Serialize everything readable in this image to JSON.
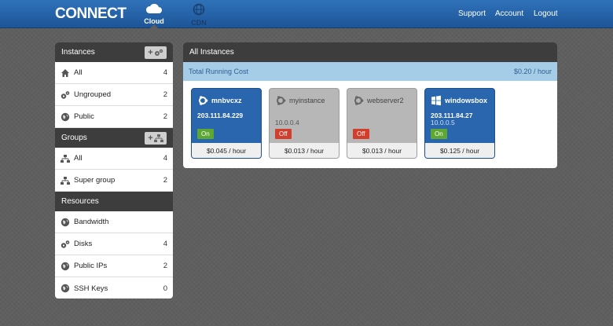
{
  "topbar": {
    "logo": "CONNECT",
    "tabs": [
      {
        "label": "Cloud",
        "icon": "cloud-icon"
      },
      {
        "label": "CDN",
        "icon": "globe-icon"
      }
    ],
    "links": [
      "Support",
      "Account",
      "Logout"
    ]
  },
  "sidebar": {
    "instances": {
      "title": "Instances",
      "items": [
        {
          "label": "All",
          "count": "4",
          "icon": "home-icon"
        },
        {
          "label": "Ungrouped",
          "count": "2",
          "icon": "gears-icon"
        },
        {
          "label": "Public",
          "count": "2",
          "icon": "globe-icon"
        }
      ]
    },
    "groups": {
      "title": "Groups",
      "items": [
        {
          "label": "All",
          "count": "4",
          "icon": "hierarchy-icon"
        },
        {
          "label": "Super group",
          "count": "2",
          "icon": "hierarchy-icon"
        }
      ]
    },
    "resources": {
      "title": "Resources",
      "items": [
        {
          "label": "Bandwidth",
          "count": "",
          "icon": "globe-icon"
        },
        {
          "label": "Disks",
          "count": "4",
          "icon": "gears-icon"
        },
        {
          "label": "Public IPs",
          "count": "2",
          "icon": "globe-icon"
        },
        {
          "label": "SSH Keys",
          "count": "0",
          "icon": "globe-icon"
        }
      ]
    }
  },
  "main": {
    "title": "All Instances",
    "cost_label": "Total Running Cost",
    "cost_value": "$0.20 / hour",
    "instances": [
      {
        "name": "mnbvcxz",
        "ip": "203.111.84.229",
        "ip_private": "",
        "status": "On",
        "price": "$0.045 / hour",
        "os_icon": "ubuntu-icon"
      },
      {
        "name": "myinstance",
        "ip": "",
        "ip_private": "10.0.0.4",
        "status": "Off",
        "price": "$0.013 / hour",
        "os_icon": "ubuntu-icon"
      },
      {
        "name": "webserver2",
        "ip": "",
        "ip_private": "",
        "status": "Off",
        "price": "$0.013 / hour",
        "os_icon": "ubuntu-icon"
      },
      {
        "name": "windowsbox",
        "ip": "203.111.84.27",
        "ip_private": "10.0.0.5",
        "status": "On",
        "price": "$0.125 / hour",
        "os_icon": "windows-icon"
      }
    ]
  },
  "colors": {
    "topbar": "#2a66ad",
    "on_card": "#2a66ad",
    "off_card": "#b7b7b7",
    "status_on": "#5ea732",
    "status_off": "#d33e2c",
    "cost_bar": "#a6cde7"
  }
}
